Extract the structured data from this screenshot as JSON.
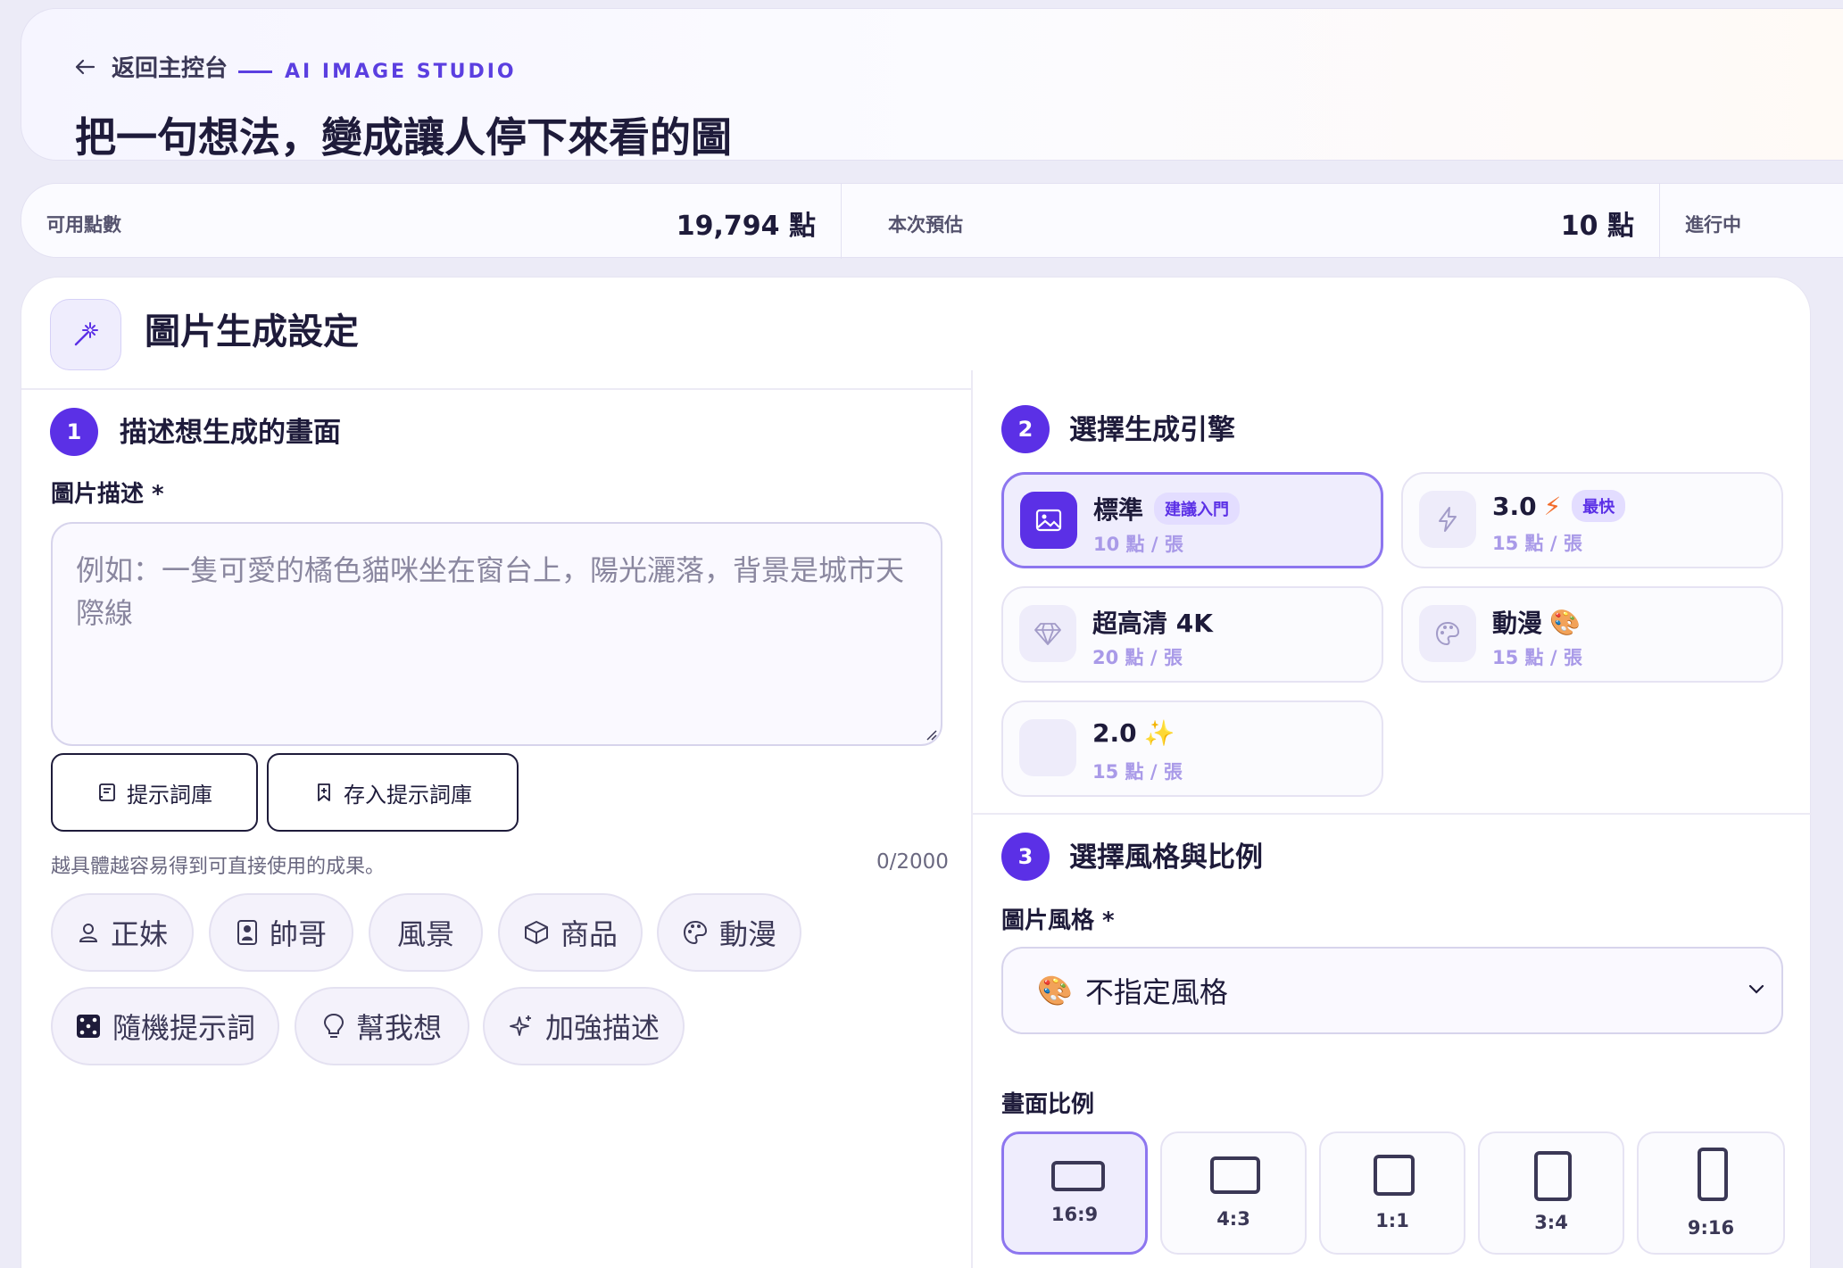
{
  "header": {
    "back_label": "返回主控台",
    "brand": "AI IMAGE STUDIO",
    "title": "把一句想法，變成讓人停下來看的圖"
  },
  "stats": {
    "available_label": "可用點數",
    "available_value": "19,794 點",
    "estimate_label": "本次預估",
    "estimate_value": "10 點",
    "status_label": "進行中"
  },
  "card": {
    "title": "圖片生成設定"
  },
  "step1": {
    "num": "1",
    "title": "描述想生成的畫面",
    "field_label": "圖片描述 *",
    "placeholder": "例如：一隻可愛的橘色貓咪坐在窗台上，陽光灑落，背景是城市天際線",
    "library_button": "提示詞庫",
    "save_button": "存入提示詞庫",
    "hint": "越具體越容易得到可直接使用的成果。",
    "counter": "0/2000",
    "chips": [
      {
        "label": "正妹",
        "icon": "user-icon"
      },
      {
        "label": "帥哥",
        "icon": "portrait-icon"
      },
      {
        "label": "風景",
        "icon": ""
      },
      {
        "label": "商品",
        "icon": "box-icon"
      },
      {
        "label": "動漫",
        "icon": "palette-icon"
      }
    ],
    "actions": [
      {
        "label": "隨機提示詞",
        "icon": "dice-icon"
      },
      {
        "label": "幫我想",
        "icon": "lightbulb-icon"
      },
      {
        "label": "加強描述",
        "icon": "sparkles-icon"
      }
    ]
  },
  "step2": {
    "num": "2",
    "title": "選擇生成引擎",
    "engines": [
      {
        "name": "標準",
        "badge": "建議入門",
        "price": "10 點 / 張",
        "icon": "image-icon",
        "selected": true
      },
      {
        "name": "3.0",
        "emoji": "⚡",
        "badge": "最快",
        "price": "15 點 / 張",
        "icon": "bolt-icon",
        "selected": false
      },
      {
        "name": "超高清 4K",
        "price": "20 點 / 張",
        "icon": "diamond-icon",
        "selected": false
      },
      {
        "name": "動漫",
        "emoji": "🎨",
        "price": "15 點 / 張",
        "icon": "palette-icon",
        "selected": false
      },
      {
        "name": "2.0",
        "emoji": "✨",
        "price": "15 點 / 張",
        "icon": "blank-icon",
        "selected": false
      }
    ]
  },
  "step3": {
    "num": "3",
    "title": "選擇風格與比例",
    "style_label": "圖片風格 *",
    "style_value": "不指定風格",
    "style_emoji": "🎨",
    "ratio_label": "畫面比例",
    "ratios": [
      {
        "label": "16:9",
        "selected": true
      },
      {
        "label": "4:3",
        "selected": false
      },
      {
        "label": "1:1",
        "selected": false
      },
      {
        "label": "3:4",
        "selected": false
      },
      {
        "label": "9:16",
        "selected": false
      }
    ]
  },
  "colors": {
    "accent": "#5b30e6",
    "accent_light": "#efedfd",
    "selected_border": "#8d76ef",
    "text_dark": "#1e1b3a"
  }
}
